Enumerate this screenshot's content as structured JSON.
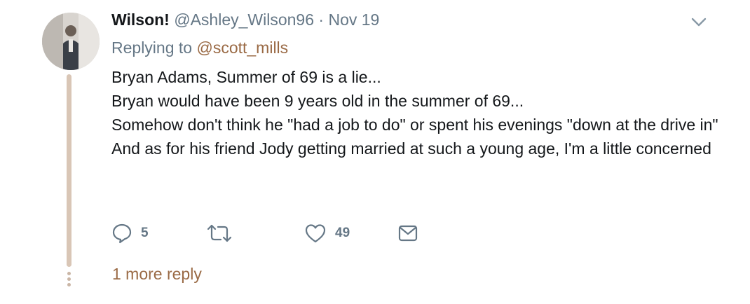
{
  "tweet": {
    "display_name": "Wilson!",
    "handle": "@Ashley_Wilson96",
    "separator": "·",
    "date": "Nov 19",
    "replying_prefix": "Replying to",
    "replying_handle": "@scott_mills",
    "lines": [
      "Bryan Adams, Summer of 69 is a lie...",
      "Bryan would have been 9 years old in the summer of 69...",
      "Somehow don't think he \"had a job to do\" or spent his evenings \"down at the drive in\"",
      "And as for his friend Jody getting married at such a young age, I'm a little concerned"
    ],
    "actions": {
      "reply_count": "5",
      "retweet_count": "",
      "like_count": "49"
    },
    "more_replies": "1 more reply"
  },
  "icons": {
    "reply": "reply-bubble-icon",
    "retweet": "retweet-icon",
    "like": "heart-icon",
    "dm": "envelope-icon",
    "menu": "chevron-down-icon"
  },
  "colors": {
    "accent": "#9a6a45",
    "muted": "#657786",
    "thread_line": "#d9c6b6"
  }
}
